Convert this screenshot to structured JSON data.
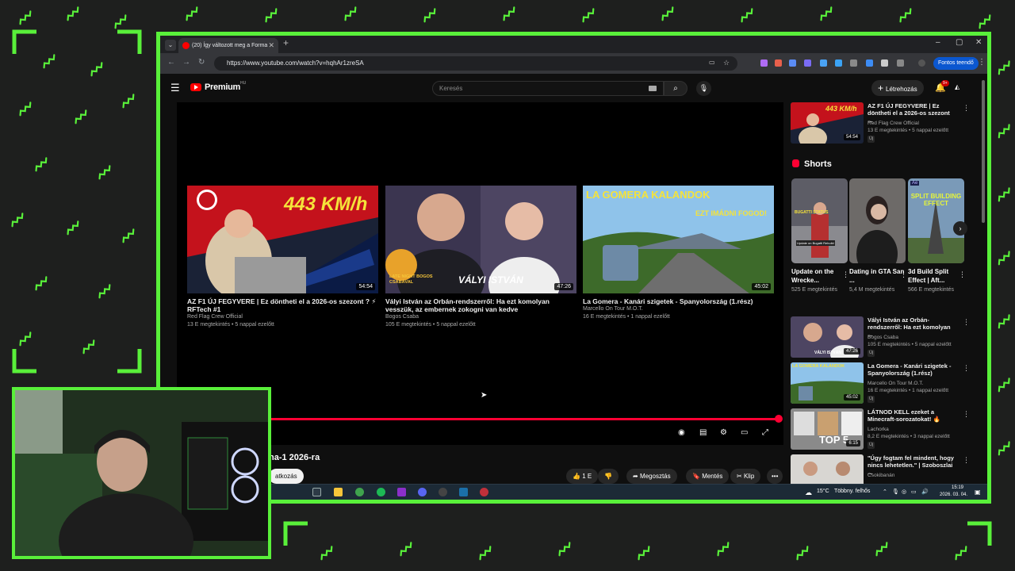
{
  "browser": {
    "tab_title": "(20) Így változott meg a Forma",
    "new_tab": "+",
    "url": "https://www.youtube.com/watch?v=hqhAr1zreSA",
    "profile_button": "Fontos teendő",
    "window_controls": [
      "–",
      "▢",
      "✕"
    ]
  },
  "youtube": {
    "brand": "Premium",
    "region": "HU",
    "search_placeholder": "Keresés",
    "create_label": "Létrehozás",
    "notifications_badge": "9+"
  },
  "endscreen": [
    {
      "title": "AZ F1 ÚJ FEGYVERE | Ez döntheti el a 2026-os szezont ? ⚡ RFTech #1",
      "channel": "Red Flag Crew Official",
      "meta": "13 E megtekintés • 5 nappal ezelőtt",
      "duration": "54:54",
      "thumb_text": "443 KM/h"
    },
    {
      "title": "Vályi István az Orbán-rendszerről: Ha ezt komolyan vesszük, az embernek zokogni van kedve",
      "channel": "Bogos Csaba",
      "meta": "105 E megtekintés • 5 nappal ezelőtt",
      "duration": "47:26",
      "thumb_text": "VÁLYI ISTVÁN",
      "thumb_badge": "LATE NIGHT BOGOS CSABÁVAL"
    },
    {
      "title": "La Gomera - Kanári szigetek - Spanyolország (1.rész)",
      "channel": "Marcello On Tour M.O.T.",
      "meta": "16 E megtekintés • 1 nappal ezelőtt",
      "duration": "45:02",
      "thumb_text": "LA GOMERA KALANDOK",
      "thumb_sub": "EZT IMÁDNI FOGOD!"
    }
  ],
  "video": {
    "title_fragment": "na-1 2026-ra",
    "subscribe_fragment": "atkozás",
    "likes": "1 E",
    "share": "Megosztás",
    "save": "Mentés",
    "clip": "Klip",
    "more": "•••"
  },
  "sidebar": {
    "top_video": {
      "title": "AZ F1 ÚJ FEGYVERE | Ez döntheti el a 2026-os szezont ...",
      "channel": "Red Flag Crew Official",
      "meta": "13 E megtekintés • 5 nappal ezelőtt",
      "tag": "Új",
      "duration": "54:54",
      "thumb_text": "443 KM/h"
    },
    "shorts_label": "Shorts",
    "shorts": [
      {
        "title": "Update on the Wrecke...",
        "views": "525 E megtekintés",
        "thumb_text": "BUGATTI STATUS",
        "thumb_sub": "Update on Bugatti Rebuild"
      },
      {
        "title": "Dating in GTA San ...",
        "views": "5,4 M megtekintés",
        "thumb_text": ""
      },
      {
        "title": "3d Build Split Effect | Aft...",
        "views": "566 E megtekintés",
        "thumb_text": "SPLIT BUILDING EFFECT",
        "thumb_badge": "Ae"
      }
    ],
    "videos": [
      {
        "title": "Vályi István az Orbán-rendszerről: Ha ezt komolyan ...",
        "channel": "Bogos Csaba",
        "meta": "105 E megtekintés • 5 nappal ezelőtt",
        "tag": "Új",
        "duration": "47:26",
        "thumb_text": "VÁLYI ISTVÁN"
      },
      {
        "title": "La Gomera - Kanári szigetek - Spanyolország (1.rész)",
        "channel": "Marcello On Tour M.O.T.",
        "meta": "16 E megtekintés • 1 nappal ezelőtt",
        "tag": "Új",
        "duration": "45:02",
        "thumb_text": "LA GOMERA KALANDOK"
      },
      {
        "title": "LÁTNOD KELL ezeket a Minecraft-sorozatokat! 🔥",
        "channel": "Lachorka",
        "meta": "8,2 E megtekintés • 3 nappal ezelőtt",
        "tag": "Új",
        "duration": "6:15",
        "thumb_text": "TOP 5"
      },
      {
        "title": "\"Úgy fogtam fel mindent, hogy nincs lehetetlen.\" | Szoboszlai ...",
        "channel": "Csokibanán",
        "meta": "",
        "tag": "",
        "duration": "",
        "thumb_text": ""
      }
    ]
  },
  "taskbar": {
    "weather": "15°C",
    "weather_desc": "Többny. felhős",
    "time": "15:19",
    "date": "2026. 03. 04."
  },
  "colors": {
    "frame_green": "#59f03a",
    "yt_red": "#ff0033",
    "background": "#0f0f0f"
  }
}
